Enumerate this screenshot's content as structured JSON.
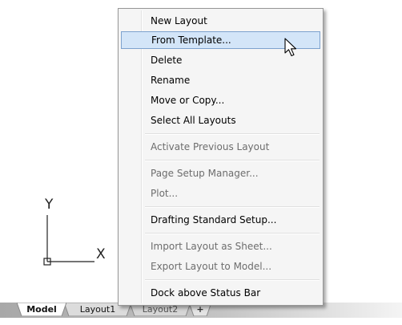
{
  "canvas": {
    "ucs": {
      "x_label": "X",
      "y_label": "Y"
    }
  },
  "context_menu": {
    "items": [
      {
        "label": "New Layout",
        "enabled": true
      },
      {
        "label": "From Template...",
        "enabled": true,
        "hovered": true
      },
      {
        "label": "Delete",
        "enabled": true
      },
      {
        "label": "Rename",
        "enabled": true
      },
      {
        "label": "Move or Copy...",
        "enabled": true
      },
      {
        "label": "Select All Layouts",
        "enabled": true
      },
      {
        "label": "Activate Previous Layout",
        "enabled": false
      },
      {
        "label": "Page Setup Manager...",
        "enabled": false
      },
      {
        "label": "Plot...",
        "enabled": false
      },
      {
        "label": "Drafting Standard Setup...",
        "enabled": true
      },
      {
        "label": "Import Layout as Sheet...",
        "enabled": false
      },
      {
        "label": "Export Layout to Model...",
        "enabled": false
      },
      {
        "label": "Dock above Status Bar",
        "enabled": true
      }
    ]
  },
  "tabs": {
    "model": "Model",
    "layout1": "Layout1",
    "layout2": "Layout2",
    "add": "+"
  },
  "colors": {
    "menu_background": "#f5f5f5",
    "hover_background": "#d3e5f8",
    "hover_border": "#7da2ce",
    "disabled_text": "#6d6d6d"
  }
}
